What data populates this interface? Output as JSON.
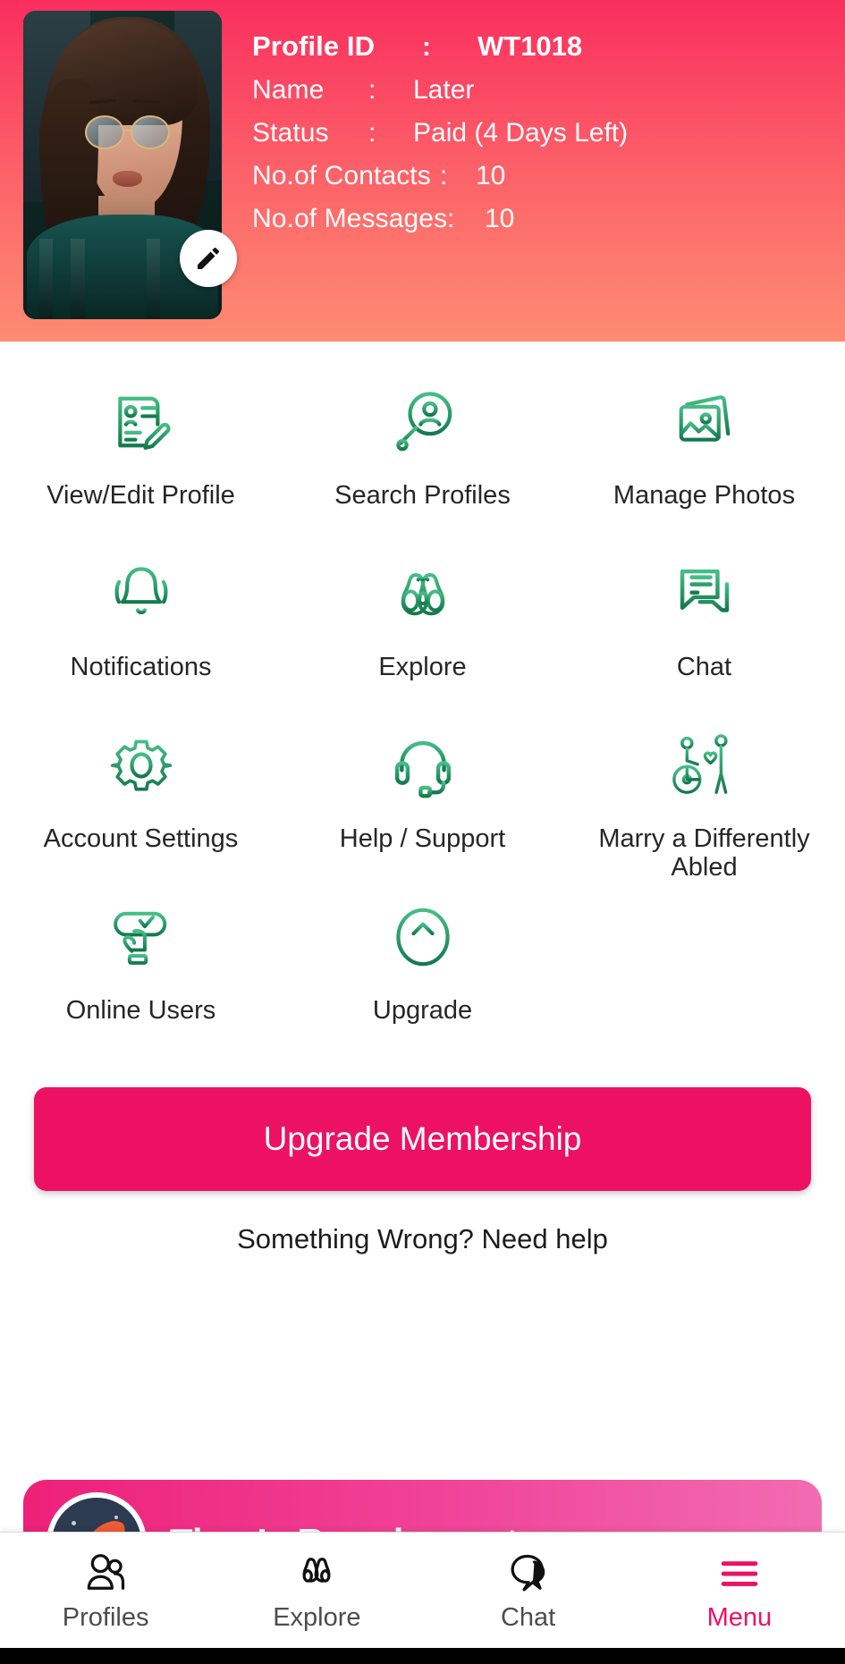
{
  "header": {
    "avatar_alt": "profile-photo",
    "edit_icon": "pencil-icon",
    "fields": [
      {
        "label": "Profile ID",
        "sep": ":",
        "value": "WT1018"
      },
      {
        "label": "Name",
        "sep": ":",
        "value": "Later"
      },
      {
        "label": "Status",
        "sep": ":",
        "value": "Paid (4 Days Left)"
      },
      {
        "label": "No.of Contacts",
        "sep": ":",
        "value": "10"
      },
      {
        "label": "No.of Messages",
        "sep": ":",
        "value": "10"
      }
    ],
    "gradient_from": "#FA2E5E",
    "gradient_to": "#FE8B74"
  },
  "grid": {
    "items": [
      {
        "label": "View/Edit Profile",
        "icon": "profile-card-edit-icon"
      },
      {
        "label": "Search Profiles",
        "icon": "search-person-icon"
      },
      {
        "label": "Manage Photos",
        "icon": "photos-stack-icon"
      },
      {
        "label": "Notifications",
        "icon": "bell-icon"
      },
      {
        "label": "Explore",
        "icon": "binoculars-icon"
      },
      {
        "label": "Chat",
        "icon": "chat-bubbles-icon"
      },
      {
        "label": "Account Settings",
        "icon": "gear-icon"
      },
      {
        "label": "Help / Support",
        "icon": "headset-icon"
      },
      {
        "label": "Marry a Differently Abled",
        "icon": "wheelchair-couple-icon"
      },
      {
        "label": "Online Users",
        "icon": "tap-check-icon"
      },
      {
        "label": "Upgrade",
        "icon": "arrow-up-circle-icon"
      }
    ],
    "icon_color_light": "#45BE86",
    "icon_color_dark": "#147A4E"
  },
  "cta": {
    "upgrade_label": "Upgrade Membership",
    "help_label": "Something Wrong? Need help",
    "color": "#ED1164"
  },
  "promo": {
    "title": "Time’s Running out",
    "icon": "rocket-icon",
    "color_from": "#EE2078",
    "color_to": "#F26CB2"
  },
  "nav": {
    "items": [
      {
        "label": "Profiles",
        "icon": "people-icon",
        "active": false
      },
      {
        "label": "Explore",
        "icon": "binoculars-icon",
        "active": false
      },
      {
        "label": "Chat",
        "icon": "chat-icon",
        "active": false
      },
      {
        "label": "Menu",
        "icon": "hamburger-icon",
        "active": true
      }
    ],
    "active_color": "#ED1164"
  }
}
